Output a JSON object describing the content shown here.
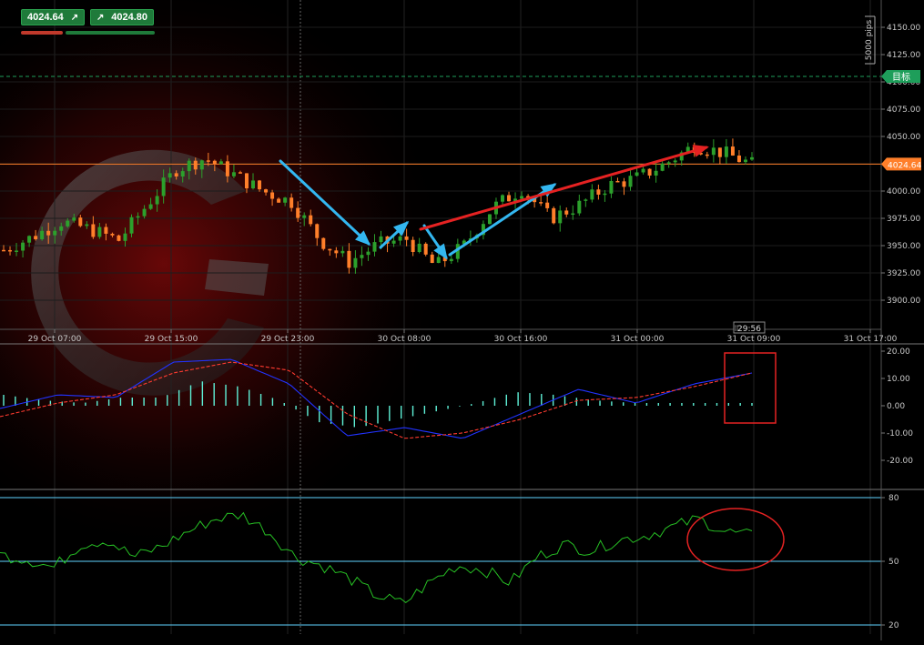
{
  "quote": {
    "bid": "4024.64",
    "ask": "4024.80",
    "bid_icon": "arrow-up-right-icon",
    "ask_icon": "arrow-up-right-icon"
  },
  "price_panel": {
    "y_ticks": [
      "4150.00",
      "4125.00",
      "4100.00",
      "4075.00",
      "4050.00",
      "4025.00",
      "4000.00",
      "3975.00",
      "3950.00",
      "3925.00",
      "3900.00"
    ],
    "x_ticks": [
      "29 Oct 07:00",
      "29 Oct 15:00",
      "29 Oct 23:00",
      "30 Oct 08:00",
      "30 Oct 16:00",
      "31 Oct 00:00",
      "31 Oct 09:00",
      "31 Oct 17:00"
    ],
    "scale_label": "5000 pips",
    "target_label": "目标",
    "target_price": 4105,
    "current_price_label": "4024.64",
    "current_price": 4024.64,
    "countdown": "29:56",
    "colors": {
      "up": "#2ca02c",
      "down": "#ff7f2a",
      "price_line": "#ff7f2a",
      "target": "#1e9e5a"
    }
  },
  "macd_panel": {
    "y_ticks": [
      "20.00",
      "10.00",
      "0.00",
      "-10.00",
      "-20.00"
    ],
    "colors": {
      "macd": "#2233ff",
      "signal": "#ff3b30",
      "hist": "#5ff2d8"
    }
  },
  "rsi_panel": {
    "y_ticks": [
      "80",
      "50",
      "20"
    ],
    "colors": {
      "rsi": "#27c024",
      "levels": "#5fd3ff"
    }
  },
  "annotations": {
    "colors": {
      "blue_arrow": "#33b7f0",
      "red_arrow": "#e52222",
      "box": "#e52222"
    }
  },
  "chart_data": [
    {
      "type": "line",
      "subtype": "candlestick",
      "x": [
        "29 Oct 07:00",
        "29 Oct 09:00",
        "29 Oct 11:00",
        "29 Oct 13:00",
        "29 Oct 15:00",
        "29 Oct 17:00",
        "29 Oct 19:00",
        "29 Oct 21:00",
        "29 Oct 23:00",
        "30 Oct 01:00",
        "30 Oct 03:00",
        "30 Oct 05:00",
        "30 Oct 07:00",
        "30 Oct 08:00",
        "30 Oct 10:00",
        "30 Oct 12:00",
        "30 Oct 14:00",
        "30 Oct 16:00",
        "30 Oct 18:00",
        "30 Oct 20:00",
        "30 Oct 22:00",
        "31 Oct 00:00",
        "31 Oct 02:00",
        "31 Oct 04:00",
        "31 Oct 06:00",
        "31 Oct 08:00",
        "31 Oct 10:00"
      ],
      "close": [
        3946,
        3958,
        3972,
        3965,
        3955,
        3988,
        4020,
        4030,
        4015,
        4000,
        3990,
        3955,
        3935,
        3951,
        3956,
        3931,
        3950,
        3985,
        4002,
        3975,
        3987,
        4005,
        4012,
        4025,
        4042,
        4035,
        4024.64
      ],
      "ylim": [
        3880,
        4160
      ],
      "annotations": [
        "current price 4024.64",
        "target line 4105"
      ]
    },
    {
      "type": "line",
      "series": [
        {
          "name": "MACD",
          "x": [
            0,
            2,
            4,
            6,
            8,
            10,
            12,
            14,
            16,
            18,
            20,
            22,
            24,
            26
          ],
          "values": [
            -1,
            4,
            3,
            16,
            17,
            8,
            -11,
            -8,
            -12,
            -3,
            6,
            1,
            8,
            12
          ]
        },
        {
          "name": "Signal",
          "x": [
            0,
            2,
            4,
            6,
            8,
            10,
            12,
            14,
            16,
            18,
            20,
            22,
            24,
            26
          ],
          "values": [
            -4,
            1,
            4,
            12,
            16,
            13,
            -3,
            -12,
            -10,
            -5,
            2,
            3,
            7,
            12
          ]
        }
      ],
      "histogram": [
        4,
        2,
        1,
        3,
        3,
        9,
        7,
        2,
        -6,
        -8,
        -5,
        -2,
        1,
        5,
        4,
        2,
        1,
        1,
        1,
        1
      ],
      "ylim": [
        -26,
        22
      ]
    },
    {
      "type": "line",
      "series": [
        {
          "name": "RSI",
          "values": [
            53,
            51,
            47,
            58,
            60,
            52,
            57,
            64,
            70,
            72,
            64,
            52,
            48,
            42,
            34,
            30,
            40,
            48,
            46,
            40,
            52,
            58,
            55,
            60,
            62,
            66,
            70,
            64,
            62
          ]
        }
      ],
      "levels": [
        80,
        50,
        20
      ],
      "ylim": [
        18,
        82
      ]
    }
  ]
}
